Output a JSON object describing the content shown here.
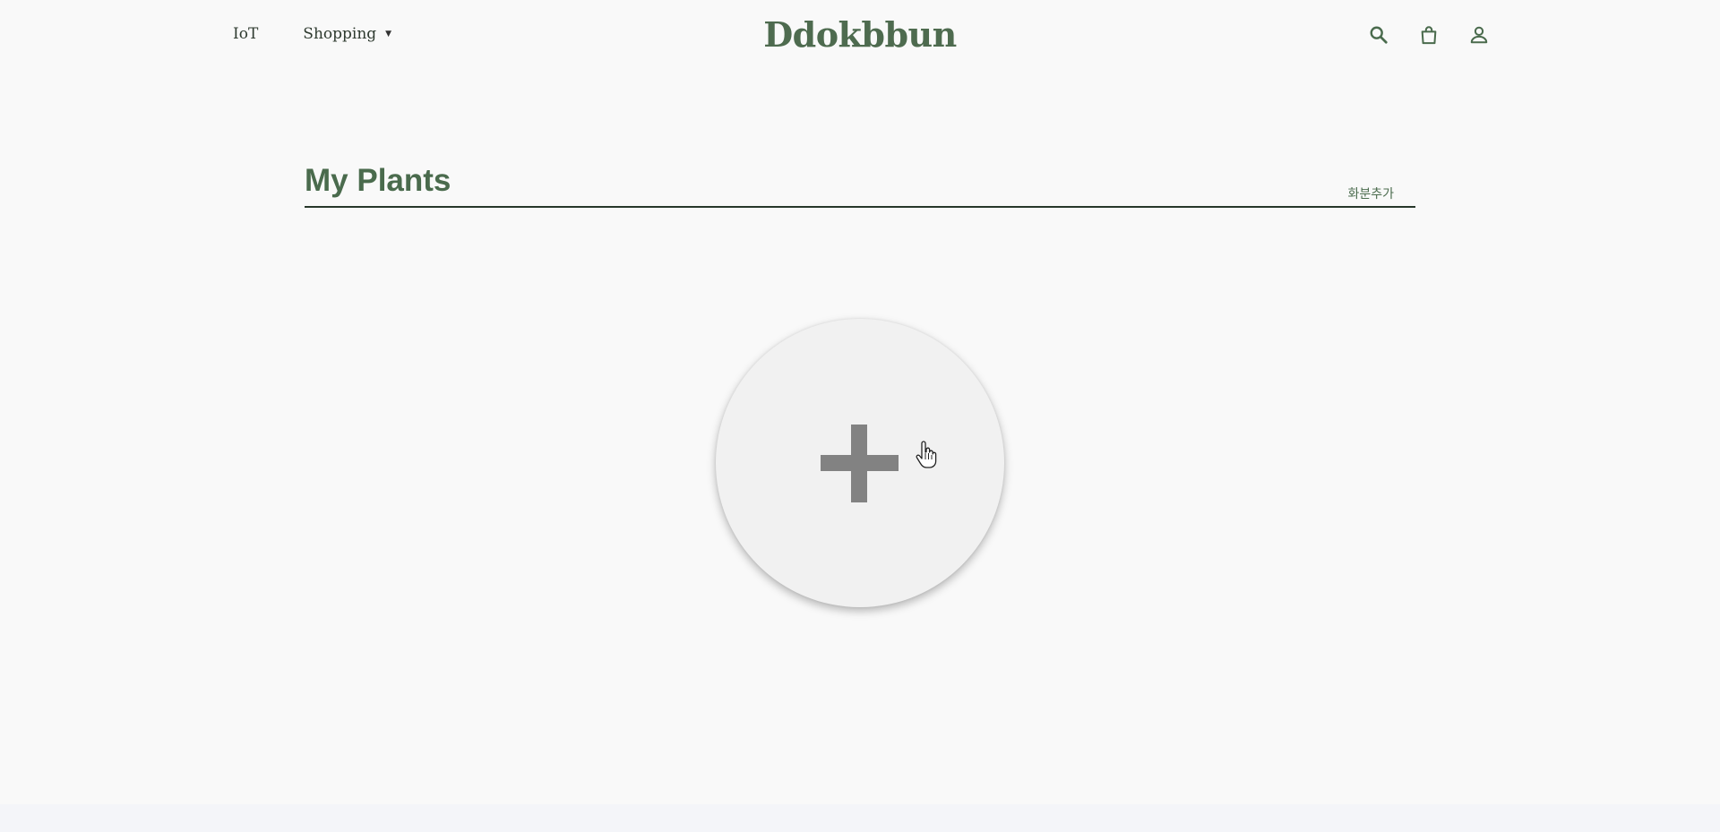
{
  "header": {
    "nav": [
      {
        "label": "IoT"
      },
      {
        "label": "Shopping",
        "caret": "▼"
      }
    ],
    "logo": "Ddokbbun",
    "icons": [
      "search-icon",
      "shopping-bag-icon",
      "user-icon"
    ]
  },
  "main": {
    "title": "My Plants",
    "add_label": "화분추가",
    "add_button_icon": "plus-icon"
  },
  "colors": {
    "brand_green": "#4a6b4d",
    "nav_text": "#2f3b30",
    "background": "#f9f9f9",
    "circle_bg": "#f1f1f1",
    "plus": "#828282"
  }
}
